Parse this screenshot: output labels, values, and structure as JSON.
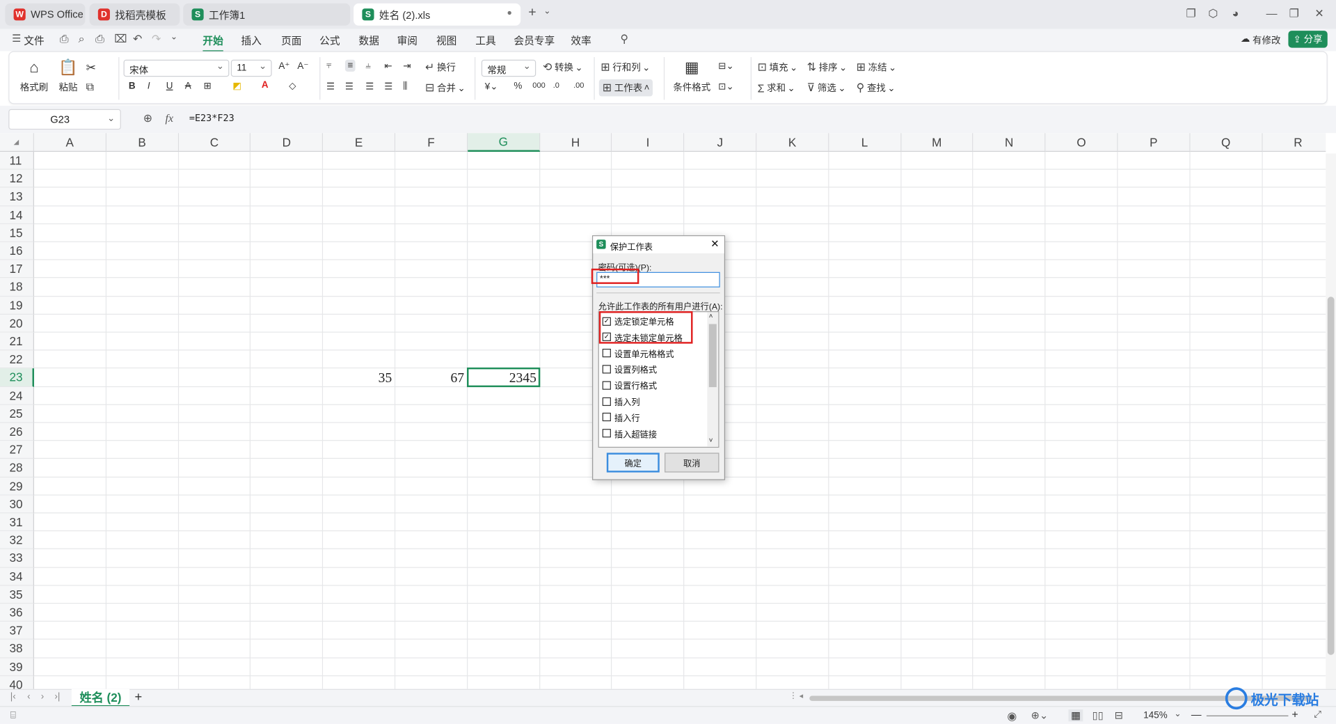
{
  "tabs": [
    {
      "label": "WPS Office",
      "icon": "wps-logo-icon"
    },
    {
      "label": "找稻壳模板",
      "icon": "docer-icon"
    },
    {
      "label": "工作簿1",
      "icon": "sheet-icon"
    },
    {
      "label": "姓名 (2).xls",
      "icon": "sheet-icon"
    }
  ],
  "menu": {
    "file": "文件",
    "items": [
      "开始",
      "插入",
      "页面",
      "公式",
      "数据",
      "审阅",
      "视图",
      "工具",
      "会员专享",
      "效率"
    ],
    "active": "开始",
    "modified": "有修改",
    "share": "分享"
  },
  "ribbon": {
    "format_painter": "格式刷",
    "paste": "粘贴",
    "font_name": "宋体",
    "font_size": "11",
    "wrap": "换行",
    "merge": "合并",
    "number_format": "常规",
    "convert": "转换",
    "rows_cols": "行和列",
    "worksheet": "工作表",
    "cond_format": "条件格式",
    "fill": "填充",
    "sort": "排序",
    "freeze": "冻结",
    "sum": "求和",
    "filter": "筛选",
    "find": "查找"
  },
  "formula_bar": {
    "cell_ref": "G23",
    "fx": "fx",
    "formula": "=E23*F23"
  },
  "columns": [
    "A",
    "B",
    "C",
    "D",
    "E",
    "F",
    "G",
    "H",
    "I",
    "J",
    "K",
    "L",
    "M",
    "N",
    "O",
    "P",
    "Q",
    "R"
  ],
  "rows": [
    "11",
    "12",
    "13",
    "14",
    "15",
    "16",
    "17",
    "18",
    "19",
    "20",
    "21",
    "22",
    "23",
    "24",
    "25",
    "26",
    "27",
    "28",
    "29",
    "30",
    "31",
    "32",
    "33",
    "34",
    "35",
    "36",
    "37",
    "38",
    "39",
    "40"
  ],
  "cells": {
    "E23": "35",
    "F23": "67",
    "G23": "2345"
  },
  "selected": {
    "column": "G",
    "row": "23"
  },
  "sheet_tab": "姓名 (2)",
  "zoom": "145%",
  "dialog": {
    "title": "保护工作表",
    "password_label": "密码(可选)(P):",
    "password_value": "***",
    "allow_label": "允许此工作表的所有用户进行(A):",
    "options": [
      {
        "label": "选定锁定单元格",
        "checked": true
      },
      {
        "label": "选定未锁定单元格",
        "checked": true
      },
      {
        "label": "设置单元格格式",
        "checked": false
      },
      {
        "label": "设置列格式",
        "checked": false
      },
      {
        "label": "设置行格式",
        "checked": false
      },
      {
        "label": "插入列",
        "checked": false
      },
      {
        "label": "插入行",
        "checked": false
      },
      {
        "label": "插入超链接",
        "checked": false
      }
    ],
    "ok": "确定",
    "cancel": "取消"
  },
  "watermark": "极光下载站",
  "colors": {
    "accent": "#1e8e5a",
    "highlight": "#e02020"
  }
}
